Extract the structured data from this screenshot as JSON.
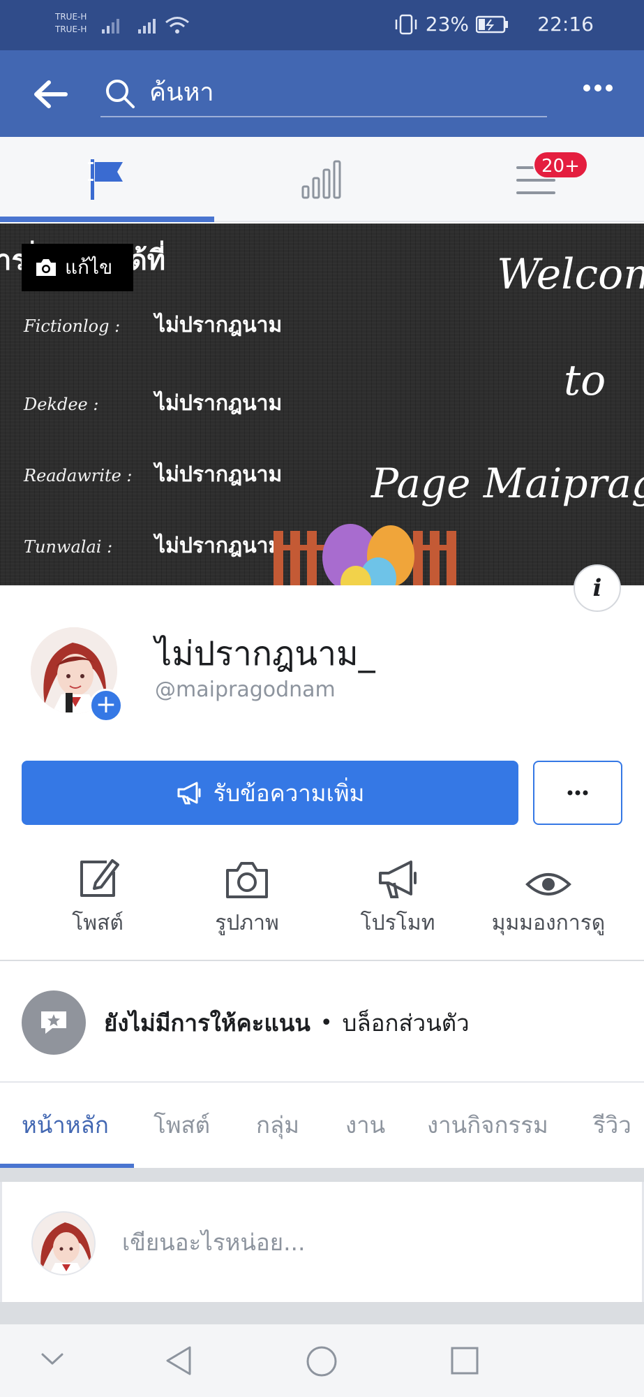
{
  "status_bar": {
    "carrier_1": "TRUE-H",
    "carrier_2": "TRUE-H",
    "battery_percent": "23%",
    "time": "22:16"
  },
  "top_bar": {
    "search_placeholder": "ค้นหา",
    "icons": [
      "back-arrow-icon",
      "search-icon",
      "more-dots-icon"
    ]
  },
  "tab_strip": {
    "tabs": [
      "flag-icon",
      "insights-bars-icon",
      "menu-lines-icon"
    ],
    "active_tab": 0,
    "menu_badge": "20+"
  },
  "cover": {
    "edit_label": "แก้ไข",
    "headline_visible": "าร   ่าวสารได้ที่",
    "rows": [
      {
        "site": "Fictionlog :",
        "name": "ไม่ปรากฎนาม"
      },
      {
        "site": "Dekdee :",
        "name": "ไม่ปรากฎนาม"
      },
      {
        "site": "Readawrite :",
        "name": "ไม่ปรากฎนาม"
      },
      {
        "site": "Tunwalai :",
        "name": "ไม่ปรากฎนาม"
      }
    ],
    "welcome_1": "Welcom",
    "welcome_2": "to",
    "welcome_3": "Page Maiprago",
    "info_label": "i"
  },
  "profile": {
    "name": "ไม่ปรากฎนาม_",
    "handle": "@maipragodnam"
  },
  "buttons": {
    "primary_label": "รับข้อความเพิ่ม",
    "more_label": "•••"
  },
  "actions": [
    {
      "label": "โพสต์",
      "icon": "compose-icon"
    },
    {
      "label": "รูปภาพ",
      "icon": "camera-icon"
    },
    {
      "label": "โปรโมท",
      "icon": "megaphone-icon"
    },
    {
      "label": "มุมมองการดู",
      "icon": "eye-icon"
    }
  ],
  "rating": {
    "text": "ยังไม่มีการให้คะแนน",
    "dot": "•",
    "note": "บล็อกส่วนตัว"
  },
  "page_tabs": [
    "หน้าหลัก",
    "โพสต์",
    "กลุ่ม",
    "งาน",
    "งานกิจกรรม",
    "รีวิว"
  ],
  "composer": {
    "placeholder": "เขียนอะไรหน่อย..."
  },
  "colors": {
    "status_bar": "#304c8a",
    "top_bar": "#4267b2",
    "accent": "#3578e5",
    "badge": "#e41e3f"
  }
}
